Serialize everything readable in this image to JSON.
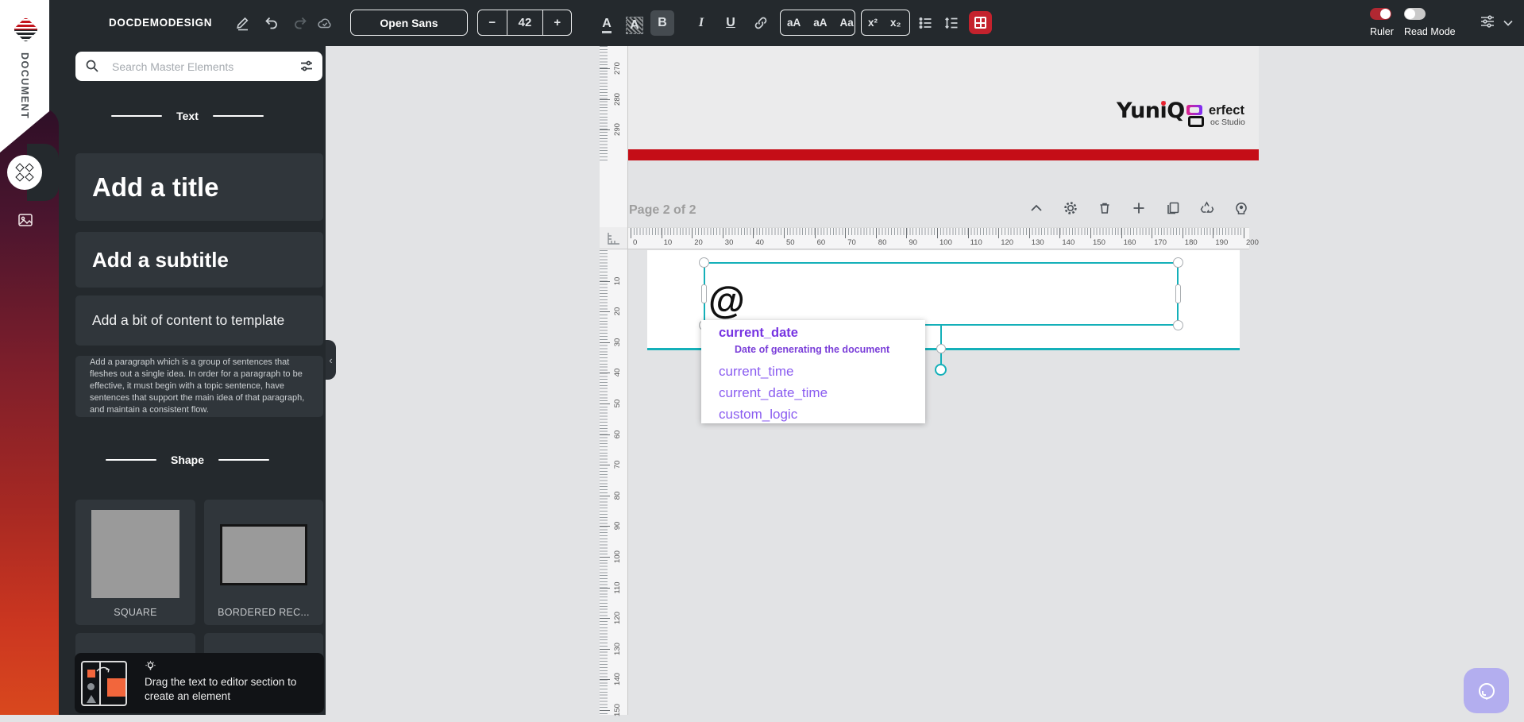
{
  "topbar": {
    "title": "DOCDEMODESIGN",
    "font_button": "Open Sans",
    "size_minus": "−",
    "size_value": "42",
    "size_plus": "+",
    "text_color_label": "A",
    "highlight_label": "A",
    "bold_label": "B",
    "italic_label": "I",
    "underline_label": "U",
    "case_upper": "aA",
    "case_lower": "aA",
    "case_title": "Aa",
    "superscript": "x²",
    "subscript": "x₂",
    "ruler_toggle_label": "Ruler",
    "read_mode_toggle_label": "Read Mode"
  },
  "rail": {
    "section_label": "DOCUMENT"
  },
  "sidebar": {
    "search_placeholder": "Search Master Elements",
    "text_section_label": "Text",
    "shape_section_label": "Shape",
    "cards": {
      "title": "Add a title",
      "subtitle": "Add a subtitle",
      "content": "Add a bit of content to template",
      "paragraph": "Add a paragraph which is a group of sentences that fleshes out a single idea. In order for a paragraph to be effective, it must begin with a topic sentence, have sentences that support the main idea of that paragraph, and maintain a consistent flow."
    },
    "shapes": [
      {
        "label": "SQUARE"
      },
      {
        "label": "BORDERED REC..."
      }
    ],
    "hint": "Drag the text to editor section to create an element"
  },
  "canvas": {
    "page_label": "Page 2 of 2",
    "brand_primary": "YuniQ",
    "brand_secondary_top": "erfect",
    "brand_secondary_bottom": "oc Studio",
    "element_text": "@",
    "collapse_glyph": "‹",
    "h_ruler_labels": [
      "0",
      "10",
      "20",
      "30",
      "40",
      "50",
      "60",
      "70",
      "80",
      "90",
      "100",
      "110",
      "120",
      "130",
      "140",
      "150",
      "160",
      "170",
      "180",
      "190",
      "200"
    ],
    "v_ruler_top_labels": [
      "270",
      "280",
      "290"
    ],
    "v_ruler_page_labels": [
      "10",
      "20",
      "30",
      "40",
      "50",
      "60",
      "70",
      "80",
      "90",
      "100",
      "110",
      "120",
      "130",
      "140",
      "150"
    ]
  },
  "dropdown": {
    "items": [
      {
        "label": "current_date",
        "description": "Date of generating the document"
      },
      {
        "label": "current_time"
      },
      {
        "label": "current_date_time"
      },
      {
        "label": "custom_logic"
      }
    ]
  },
  "colors": {
    "accent_teal": "#14b0b9",
    "accent_red": "#c4222d",
    "page_bar_red": "#c50d17",
    "dropdown_purple": "#7633e2"
  }
}
